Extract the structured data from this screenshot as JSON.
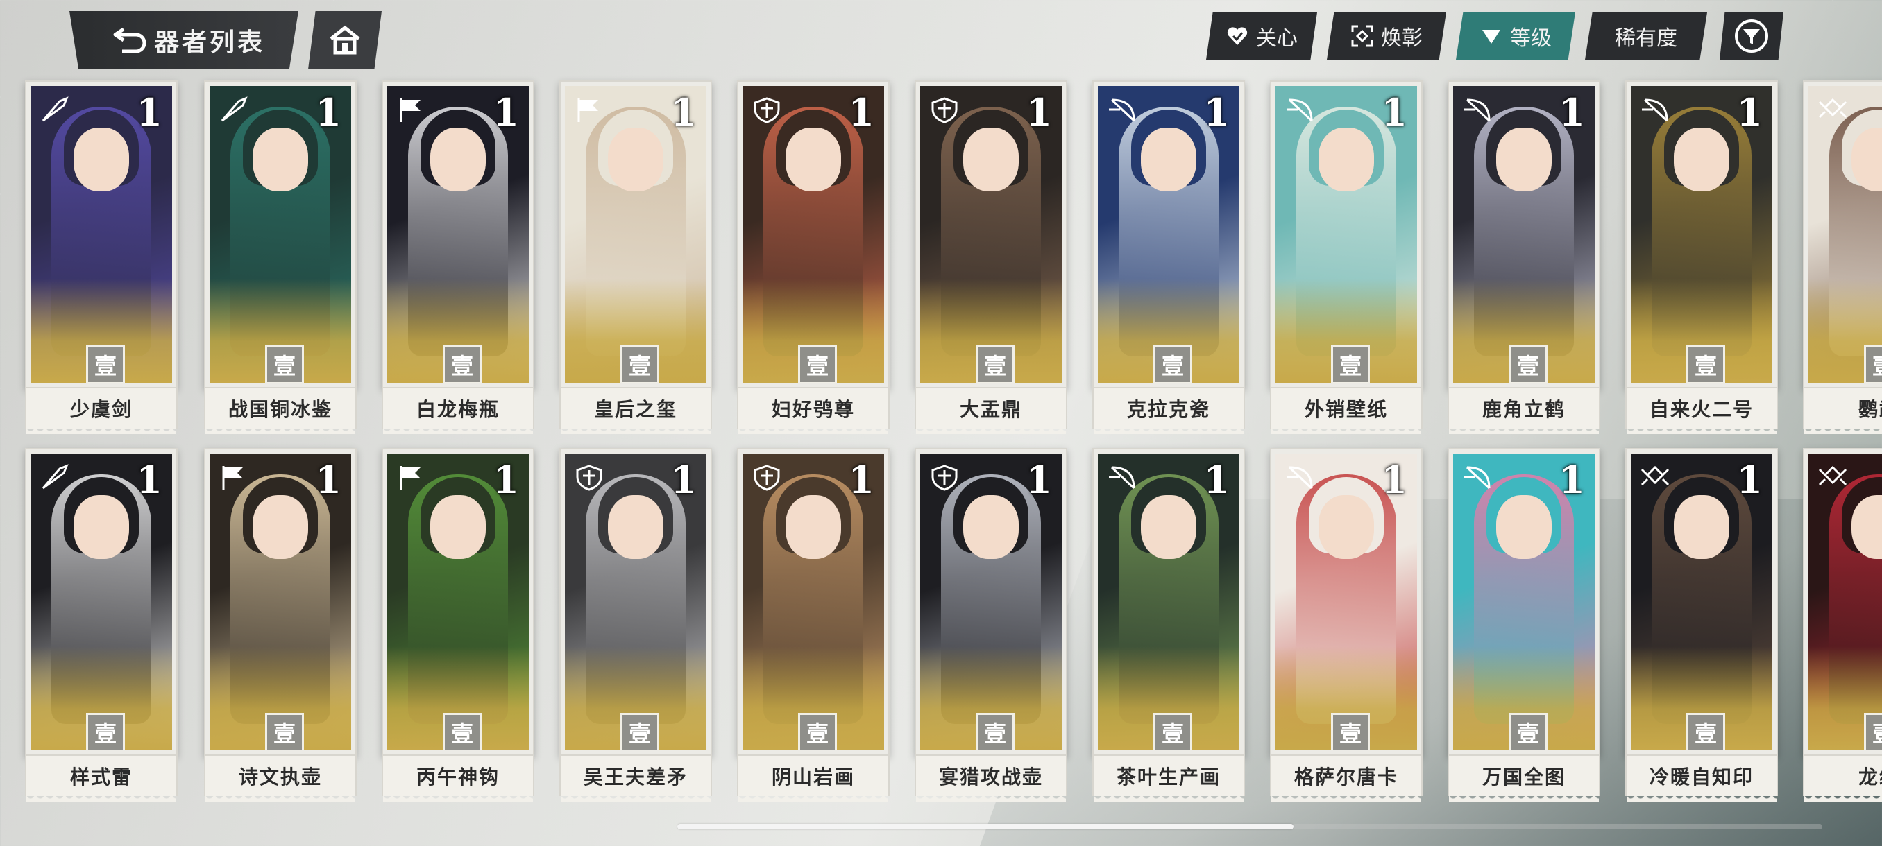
{
  "header": {
    "title": "器者列表",
    "tabs": [
      {
        "label": "关心",
        "icon": "heart-check-icon",
        "active": false
      },
      {
        "label": "焕彰",
        "icon": "frame-scan-icon",
        "active": false
      },
      {
        "label": "等级",
        "icon": "triangle-down-icon",
        "active": true
      },
      {
        "label": "稀有度",
        "icon": "",
        "active": false
      }
    ],
    "accent_color": "#2f7c77"
  },
  "rank_glyph": "壹",
  "cards_row1": [
    {
      "name": "少虞剑",
      "level": "1",
      "class_icon": "quill-icon",
      "palette": [
        "#2c2a4a",
        "#5a4fb0"
      ]
    },
    {
      "name": "战国铜冰鉴",
      "level": "1",
      "class_icon": "quill-icon",
      "palette": [
        "#1f3a35",
        "#2e7a6e"
      ]
    },
    {
      "name": "白龙梅瓶",
      "level": "1",
      "class_icon": "flag-icon",
      "palette": [
        "#1d1d26",
        "#e9e9ec"
      ]
    },
    {
      "name": "皇后之玺",
      "level": "1",
      "class_icon": "flag-icon",
      "palette": [
        "#e8e3d6",
        "#cbb59a"
      ]
    },
    {
      "name": "妇好鸮尊",
      "level": "1",
      "class_icon": "shield-icon",
      "palette": [
        "#3a2a22",
        "#d4694d"
      ]
    },
    {
      "name": "大盂鼎",
      "level": "1",
      "class_icon": "shield-icon",
      "palette": [
        "#2b2623",
        "#8b6c55"
      ]
    },
    {
      "name": "克拉克瓷",
      "level": "1",
      "class_icon": "bow-icon",
      "palette": [
        "#253a6e",
        "#dbe6f0"
      ]
    },
    {
      "name": "外销壁纸",
      "level": "1",
      "class_icon": "bow-icon",
      "palette": [
        "#6fb8b5",
        "#e8eee5"
      ]
    },
    {
      "name": "鹿角立鹤",
      "level": "1",
      "class_icon": "bow-icon",
      "palette": [
        "#2a2a33",
        "#c9c9dc"
      ]
    },
    {
      "name": "自来火二号",
      "level": "1",
      "class_icon": "bow-icon",
      "palette": [
        "#30302c",
        "#a88a3a"
      ]
    },
    {
      "name": "鹦鹉",
      "level": "",
      "class_icon": "knot-icon",
      "palette": [
        "#e8e2d8",
        "#6a4a3a"
      ]
    }
  ],
  "cards_row2": [
    {
      "name": "样式雷",
      "level": "1",
      "class_icon": "quill-icon",
      "palette": [
        "#1e1e22",
        "#ededee"
      ]
    },
    {
      "name": "诗文执壶",
      "level": "1",
      "class_icon": "flag-icon",
      "palette": [
        "#2e2822",
        "#e4cfa8"
      ]
    },
    {
      "name": "丙午神钩",
      "level": "1",
      "class_icon": "flag-icon",
      "palette": [
        "#2a3a24",
        "#5a9a3c"
      ]
    },
    {
      "name": "吴王夫差矛",
      "level": "1",
      "class_icon": "shield-icon",
      "palette": [
        "#3a3a3c",
        "#cfcfd2"
      ]
    },
    {
      "name": "阴山岩画",
      "level": "1",
      "class_icon": "shield-icon",
      "palette": [
        "#4a3a2c",
        "#c99a6a"
      ]
    },
    {
      "name": "宴猎攻战壶",
      "level": "1",
      "class_icon": "shield-icon",
      "palette": [
        "#1e1e22",
        "#c8ccd6"
      ]
    },
    {
      "name": "茶叶生产画",
      "level": "1",
      "class_icon": "bow-icon",
      "palette": [
        "#24302a",
        "#7da35a"
      ]
    },
    {
      "name": "格萨尔唐卡",
      "level": "1",
      "class_icon": "bow-icon",
      "palette": [
        "#efe9e2",
        "#c23a3a"
      ]
    },
    {
      "name": "万国全图",
      "level": "1",
      "class_icon": "bow-icon",
      "palette": [
        "#3fb7bf",
        "#e87aa8"
      ]
    },
    {
      "name": "冷暖自知印",
      "level": "1",
      "class_icon": "knot-icon",
      "palette": [
        "#1c1c20",
        "#6a5242"
      ]
    },
    {
      "name": "龙纹",
      "level": "",
      "class_icon": "knot-icon",
      "palette": [
        "#2a1616",
        "#c62a3a"
      ]
    }
  ]
}
